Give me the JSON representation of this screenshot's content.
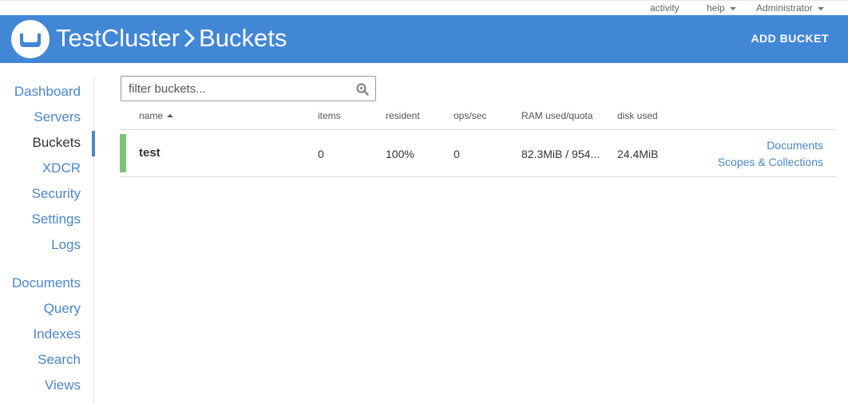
{
  "topbar": {
    "activity": "activity",
    "help": "help",
    "user": "Administrator"
  },
  "header": {
    "cluster": "TestCluster",
    "page": "Buckets",
    "add_bucket_label": "ADD BUCKET",
    "logo_icon": "couchbase-logo-icon"
  },
  "sidebar": {
    "items": [
      {
        "label": "Dashboard"
      },
      {
        "label": "Servers"
      },
      {
        "label": "Buckets",
        "active": true
      },
      {
        "label": "XDCR"
      },
      {
        "label": "Security"
      },
      {
        "label": "Settings"
      },
      {
        "label": "Logs"
      },
      {
        "label": "Documents"
      },
      {
        "label": "Query"
      },
      {
        "label": "Indexes"
      },
      {
        "label": "Search"
      },
      {
        "label": "Views"
      }
    ]
  },
  "filter": {
    "placeholder": "filter buckets...",
    "value": "",
    "icon": "search-icon"
  },
  "table": {
    "columns": [
      "name",
      "items",
      "resident",
      "ops/sec",
      "RAM used/quota",
      "disk used"
    ],
    "sorted_by": "name",
    "rows": [
      {
        "name": "test",
        "items": "0",
        "resident": "100%",
        "ops": "0",
        "ram": "82.3MiB / 954...",
        "disk": "24.4MiB",
        "status_color": "#7cc576",
        "links": [
          "Documents",
          "Scopes & Collections"
        ]
      }
    ]
  },
  "colors": {
    "header_bg": "#4287d6",
    "link": "#4a86c8",
    "healthy": "#7cc576"
  }
}
